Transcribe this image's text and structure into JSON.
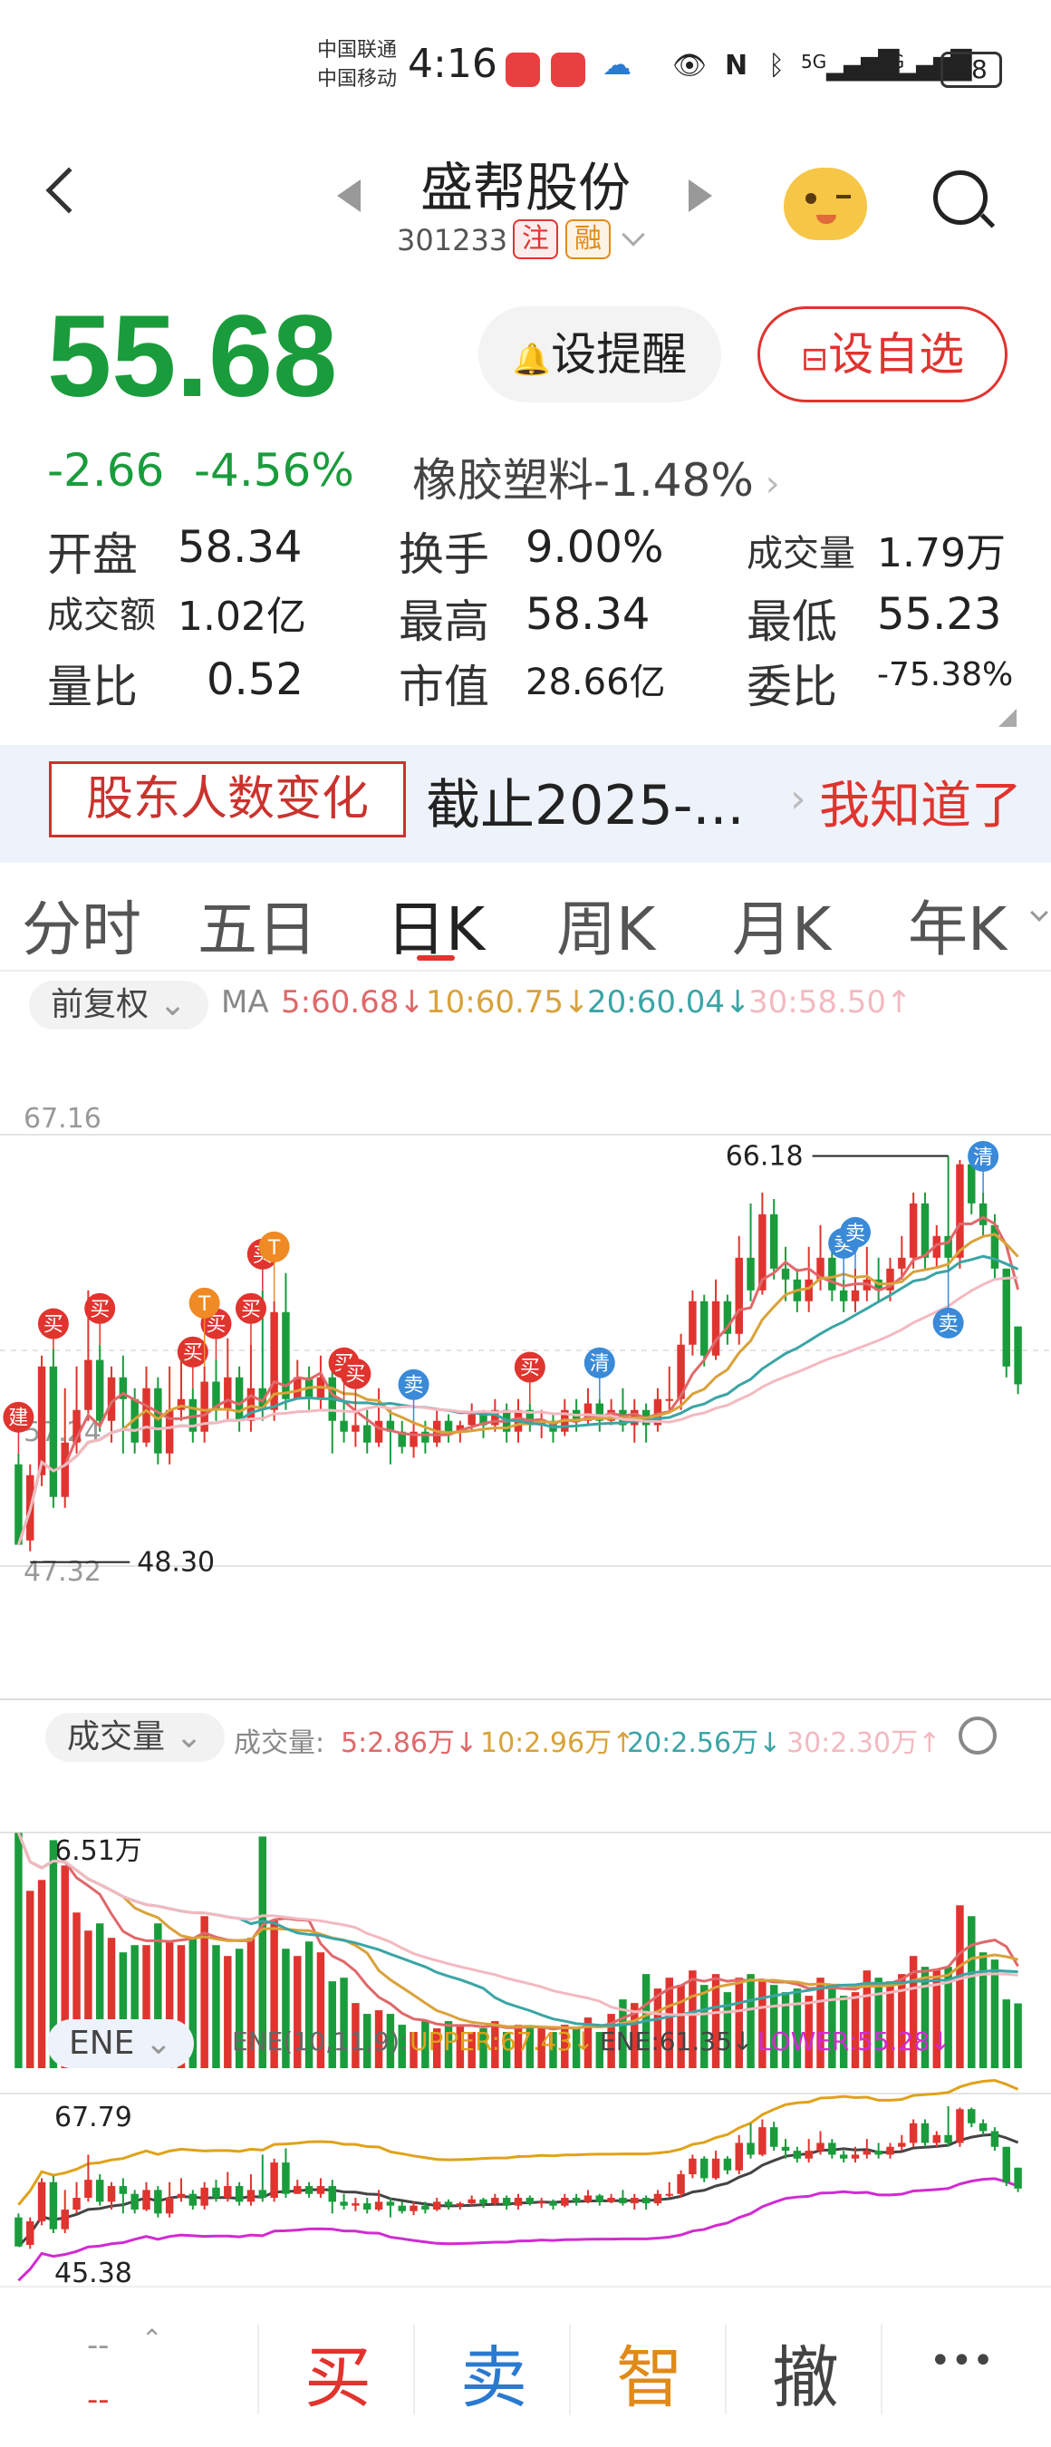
{
  "status_bar": {
    "carrier1": "中国联通",
    "carrier2": "中国移动",
    "time": "4:16",
    "network1": "5G",
    "network2": "4G",
    "battery": "88"
  },
  "header": {
    "stock_name": "盛帮股份",
    "stock_code": "301233",
    "tags": [
      "注",
      "融"
    ]
  },
  "quote": {
    "price": "55.68",
    "change": "-2.66",
    "change_pct": "-4.56%",
    "sector_name": "橡胶塑料",
    "sector_pct": "-1.48%",
    "alert_button": "设提醒",
    "fav_button": "设自选",
    "fields": {
      "open_label": "开盘",
      "open": "58.34",
      "turnover_label": "换手",
      "turnover": "9.00%",
      "volume_label": "成交量",
      "volume": "1.79万",
      "amount_label": "成交额",
      "amount": "1.02亿",
      "high_label": "最高",
      "high": "58.34",
      "low_label": "最低",
      "low": "55.23",
      "vol_ratio_label": "量比",
      "vol_ratio": "0.52",
      "mktcap_label": "市值",
      "mktcap": "28.66亿",
      "bid_ratio_label": "委比",
      "bid_ratio": "-75.38%"
    }
  },
  "banner": {
    "tag": "股东人数变化",
    "text": "截止2025-...",
    "close": "我知道了"
  },
  "tabs": [
    "分时",
    "五日",
    "日K",
    "周K",
    "月K",
    "年K"
  ],
  "active_tab": 2,
  "kline_controls": {
    "adjust": "前复权",
    "ma_label": "MA",
    "ma5": "5:60.68↓",
    "ma10": "10:60.75↓",
    "ma20": "20:60.04↓",
    "ma30": "30:58.50↑",
    "y_top": "67.16",
    "y_mid": "57.24",
    "y_bottom": "47.32",
    "max_label": "66.18",
    "min_label": "48.30"
  },
  "volume_controls": {
    "label": "成交量",
    "legend_prefix": "成交量:",
    "v5": "5:2.86万↓",
    "v10": "10:2.96万↑",
    "v20": "20:2.56万↓",
    "v30": "30:2.30万↑",
    "y_top": "6.51万",
    "y_zero": "0"
  },
  "ene_controls": {
    "label": "ENE",
    "params": "ENE(10,11,9):",
    "upper": "UPPER:67.43↓",
    "ene": "ENE:61.35↓",
    "lower": "LOWER:55.28↓",
    "y_top": "67.79",
    "y_bottom": "45.38"
  },
  "signals": {
    "buy": "买",
    "sell": "卖",
    "clear": "清",
    "build": "建",
    "t": "T"
  },
  "bottom_bar": {
    "price_placeholder": "--",
    "buy": "买",
    "sell": "卖",
    "smart": "智",
    "cancel": "撤",
    "more": "•••"
  },
  "colors": {
    "up": "#e0342f",
    "down": "#1a9c3c",
    "ma5": "#e0686a",
    "ma10": "#d9a23a",
    "ma20": "#3ba5a5",
    "ma30": "#f3b9c0",
    "ene_upper": "#e0a21a",
    "ene_mid": "#444444",
    "ene_lower": "#d12bd1"
  },
  "chart_data": {
    "type": "candlestick",
    "y_range": [
      47.32,
      67.16
    ],
    "max_marker": 66.18,
    "min_marker": 48.3,
    "candles": [
      [
        52.0,
        48.3,
        52.5,
        48.3
      ],
      [
        48.5,
        51.5,
        52.0,
        48.0
      ],
      [
        51.5,
        56.5,
        57.0,
        51.0
      ],
      [
        56.5,
        50.5,
        57.3,
        50.0
      ],
      [
        50.5,
        53.0,
        55.5,
        50.0
      ],
      [
        53.0,
        54.5,
        56.5,
        52.5
      ],
      [
        54.5,
        56.8,
        60.0,
        54.0
      ],
      [
        56.8,
        54.0,
        57.5,
        53.5
      ],
      [
        54.0,
        56.0,
        56.5,
        53.0
      ],
      [
        56.0,
        55.0,
        57.0,
        52.5
      ],
      [
        55.0,
        53.0,
        55.5,
        52.5
      ],
      [
        53.0,
        55.5,
        56.5,
        52.8
      ],
      [
        55.5,
        52.5,
        56.0,
        52.0
      ],
      [
        52.5,
        54.5,
        56.5,
        52.0
      ],
      [
        54.5,
        55.0,
        57.0,
        54.0
      ],
      [
        55.0,
        53.5,
        55.5,
        53.0
      ],
      [
        53.5,
        55.8,
        56.5,
        53.0
      ],
      [
        55.8,
        54.5,
        56.8,
        54.0
      ],
      [
        54.5,
        56.0,
        57.8,
        54.0
      ],
      [
        56.0,
        54.0,
        56.5,
        53.5
      ],
      [
        54.0,
        55.5,
        57.5,
        53.5
      ],
      [
        55.5,
        54.5,
        60.0,
        54.0
      ],
      [
        54.5,
        59.0,
        59.5,
        54.0
      ],
      [
        59.0,
        55.0,
        60.8,
        54.5
      ],
      [
        55.0,
        56.0,
        56.8,
        55.0
      ],
      [
        56.0,
        55.0,
        56.5,
        54.5
      ],
      [
        55.0,
        56.0,
        57.0,
        54.5
      ],
      [
        56.0,
        54.0,
        56.8,
        52.5
      ],
      [
        54.0,
        53.5,
        55.0,
        53.0
      ],
      [
        53.5,
        53.8,
        54.5,
        52.8
      ],
      [
        53.8,
        53.0,
        54.5,
        52.5
      ],
      [
        53.0,
        54.0,
        55.5,
        52.8
      ],
      [
        54.0,
        53.5,
        54.5,
        52.0
      ],
      [
        53.5,
        52.8,
        54.0,
        52.5
      ],
      [
        52.8,
        53.5,
        54.0,
        52.3
      ],
      [
        53.5,
        53.0,
        54.0,
        52.5
      ],
      [
        53.0,
        54.0,
        54.5,
        52.8
      ],
      [
        54.0,
        53.5,
        54.3,
        53.0
      ],
      [
        53.5,
        53.8,
        54.0,
        53.0
      ],
      [
        53.8,
        54.3,
        54.8,
        53.5
      ],
      [
        54.3,
        53.8,
        54.5,
        53.2
      ],
      [
        53.8,
        54.5,
        55.0,
        53.5
      ],
      [
        54.5,
        53.5,
        54.8,
        53.0
      ],
      [
        53.5,
        54.5,
        55.0,
        53.0
      ],
      [
        54.5,
        53.8,
        54.8,
        53.5
      ],
      [
        53.8,
        54.0,
        54.5,
        53.2
      ],
      [
        54.0,
        53.5,
        54.3,
        53.0
      ],
      [
        53.5,
        54.5,
        55.0,
        53.3
      ],
      [
        54.5,
        54.0,
        55.0,
        53.5
      ],
      [
        54.0,
        54.8,
        55.5,
        53.8
      ],
      [
        54.8,
        54.0,
        55.0,
        53.5
      ],
      [
        54.0,
        54.5,
        55.0,
        53.8
      ],
      [
        54.5,
        53.8,
        55.5,
        53.5
      ],
      [
        53.8,
        54.5,
        55.0,
        53.0
      ],
      [
        54.5,
        53.8,
        54.8,
        53.0
      ],
      [
        53.8,
        55.0,
        55.5,
        53.5
      ],
      [
        55.0,
        55.0,
        56.5,
        54.5
      ],
      [
        55.0,
        57.5,
        58.0,
        54.5
      ],
      [
        57.5,
        59.5,
        60.0,
        57.0
      ],
      [
        59.5,
        57.0,
        59.8,
        56.5
      ],
      [
        57.0,
        59.5,
        60.5,
        56.8
      ],
      [
        59.5,
        58.0,
        59.8,
        57.5
      ],
      [
        58.0,
        61.5,
        62.5,
        57.5
      ],
      [
        61.5,
        60.0,
        64.0,
        59.5
      ],
      [
        60.0,
        63.5,
        64.5,
        59.8
      ],
      [
        63.5,
        61.0,
        64.2,
        60.5
      ],
      [
        61.0,
        60.5,
        62.0,
        59.5
      ],
      [
        60.5,
        59.5,
        61.0,
        59.0
      ],
      [
        59.5,
        60.5,
        62.0,
        59.0
      ],
      [
        60.5,
        61.5,
        63.0,
        60.0
      ],
      [
        61.5,
        60.0,
        62.0,
        59.5
      ],
      [
        60.0,
        59.5,
        60.5,
        59.0
      ],
      [
        59.5,
        60.0,
        61.0,
        59.0
      ],
      [
        60.0,
        60.5,
        62.0,
        59.5
      ],
      [
        60.5,
        60.0,
        61.5,
        59.5
      ],
      [
        60.0,
        61.0,
        61.5,
        59.5
      ],
      [
        61.0,
        61.5,
        62.5,
        60.5
      ],
      [
        61.5,
        64.0,
        64.5,
        61.0
      ],
      [
        64.0,
        61.5,
        64.5,
        61.0
      ],
      [
        61.5,
        62.5,
        63.0,
        61.0
      ],
      [
        62.5,
        61.5,
        66.18,
        61.0
      ],
      [
        61.5,
        65.8,
        66.0,
        61.0
      ],
      [
        65.8,
        64.0,
        66.0,
        63.5
      ],
      [
        64.0,
        63.0,
        64.5,
        62.5
      ],
      [
        63.0,
        61.0,
        63.5,
        60.5
      ],
      [
        61.0,
        56.5,
        61.0,
        56.0
      ],
      [
        58.34,
        55.68,
        58.34,
        55.23
      ]
    ],
    "volume_y_range": [
      0,
      6.51
    ],
    "volumes": [
      6.5,
      4.9,
      5.2,
      6.3,
      5.6,
      4.3,
      3.8,
      4.0,
      3.6,
      3.2,
      3.4,
      3.4,
      4.0,
      3.5,
      3.4,
      3.6,
      4.2,
      3.4,
      3.1,
      3.3,
      3.6,
      6.4,
      4.1,
      3.3,
      3.1,
      3.5,
      3.2,
      2.4,
      2.5,
      1.8,
      1.5,
      1.6,
      1.5,
      1.2,
      1.0,
      1.3,
      1.1,
      1.3,
      1.2,
      1.0,
      1.1,
      1.3,
      1.0,
      1.2,
      1.1,
      1.1,
      1.0,
      1.2,
      1.1,
      1.4,
      1.0,
      1.5,
      1.9,
      1.8,
      2.6,
      2.2,
      2.5,
      2.3,
      2.7,
      2.3,
      2.6,
      2.1,
      2.5,
      2.6,
      2.4,
      2.3,
      2.1,
      2.2,
      2.0,
      2.5,
      2.3,
      2.0,
      2.1,
      2.7,
      2.5,
      2.4,
      2.6,
      3.1,
      2.8,
      2.7,
      2.8,
      4.5,
      4.2,
      3.2,
      3.0,
      1.9,
      1.79
    ]
  }
}
